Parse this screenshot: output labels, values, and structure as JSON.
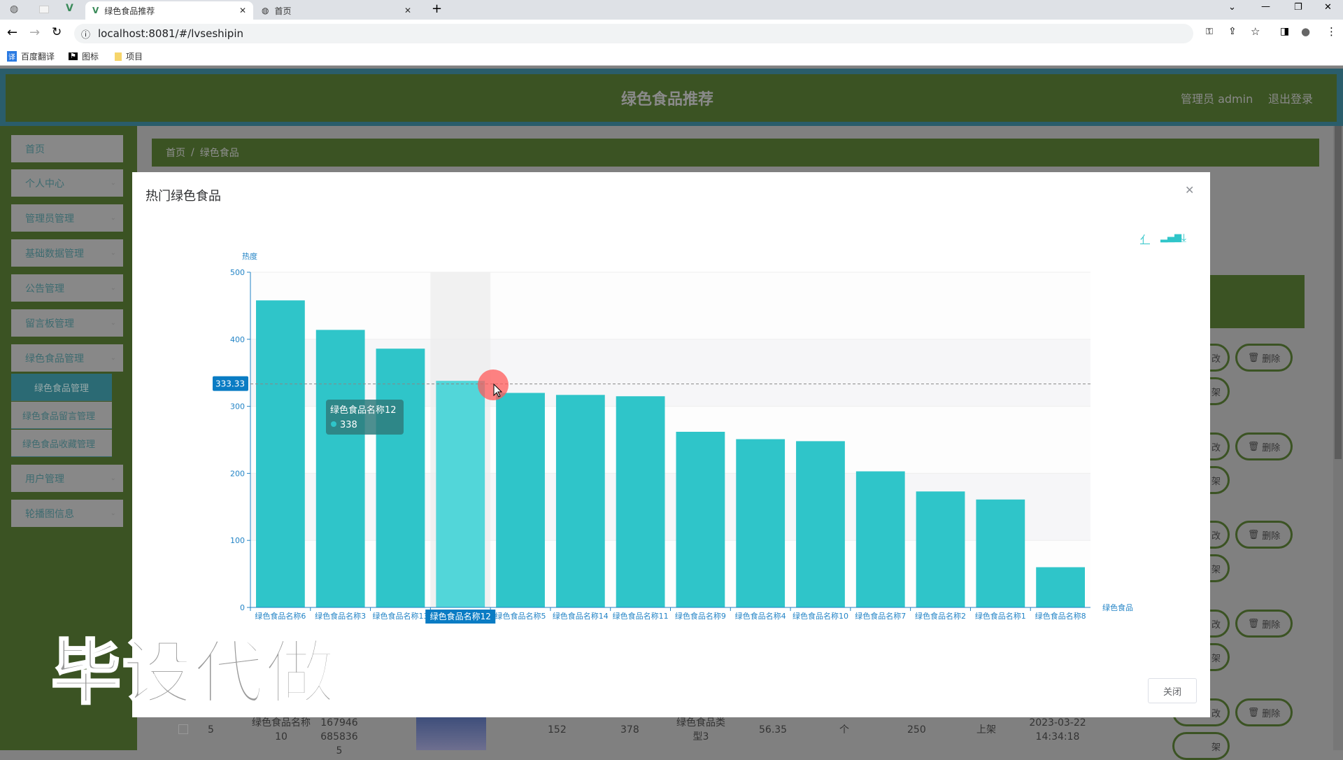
{
  "browser": {
    "tabs": [
      {
        "label": "绿色食品推荐",
        "active": true
      },
      {
        "label": "首页",
        "active": false
      }
    ],
    "url": "localhost:8081/#/lvseshipin",
    "bookmarks": [
      "百度翻译",
      "图标",
      "项目"
    ]
  },
  "header": {
    "title": "绿色食品推荐",
    "user": "管理员 admin",
    "logout": "退出登录"
  },
  "sidebar": {
    "items": [
      {
        "label": "首页"
      },
      {
        "label": "个人中心"
      },
      {
        "label": "管理员管理"
      },
      {
        "label": "基础数据管理"
      },
      {
        "label": "公告管理"
      },
      {
        "label": "留言板管理"
      },
      {
        "label": "绿色食品管理"
      },
      {
        "label": "用户管理"
      },
      {
        "label": "轮播图信息"
      }
    ],
    "submenu": [
      {
        "label": "绿色食品管理",
        "active": true
      },
      {
        "label": "绿色食品留言管理"
      },
      {
        "label": "绿色食品收藏管理"
      }
    ]
  },
  "breadcrumb": [
    "首页",
    "绿色食品"
  ],
  "modal": {
    "title": "热门绿色食品",
    "close_button": "关闭",
    "toolbox": [
      "line-chart-icon",
      "bar-chart-icon",
      "download-icon"
    ]
  },
  "chart_data": {
    "type": "bar",
    "ylabel": "热度",
    "xlabel": "绿色食品",
    "ylim": [
      0,
      500
    ],
    "yticks": [
      "0",
      "100",
      "200",
      "300",
      "400",
      "500"
    ],
    "categories": [
      "绿色食品名称6",
      "绿色食品名称3",
      "绿色食品名称13",
      "绿色食品名称12",
      "绿色食品名称5",
      "绿色食品名称14",
      "绿色食品名称11",
      "绿色食品名称9",
      "绿色食品名称4",
      "绿色食品名称10",
      "绿色食品名称7",
      "绿色食品名称2",
      "绿色食品名称1",
      "绿色食品名称8"
    ],
    "values": [
      458,
      414,
      386,
      338,
      320,
      317,
      315,
      262,
      251,
      248,
      203,
      173,
      161,
      60
    ],
    "highlighted_index": 3,
    "axis_pointer_label": "333.33",
    "tooltip": {
      "name": "绿色食品名称12",
      "value": "338"
    },
    "bar_color": "#2fc5c9",
    "highlight_color": "#52d6d9",
    "grid": true
  },
  "background_table": {
    "row": {
      "index": "5",
      "name": "绿色食品名称10",
      "code": "1679466858365",
      "v1": "152",
      "v2": "378",
      "type": "绿色食品类型3",
      "price": "56.35",
      "unit": "个",
      "stock": "250",
      "status": "上架",
      "time": "2023-03-22 14:34:18"
    },
    "delete_label": "删除",
    "edit_partial": "改",
    "shelf_partial": "架",
    "off_shelf": "下架"
  },
  "watermark": "毕设代做"
}
